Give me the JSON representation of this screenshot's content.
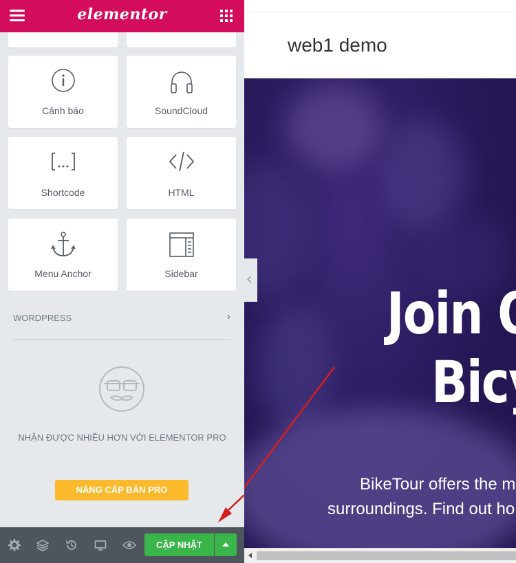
{
  "app": {
    "logo_text": "elementor",
    "brand_color": "#d30c5c"
  },
  "widgets": [
    {
      "label": "Cảnh báo",
      "icon": "alert-info-icon"
    },
    {
      "label": "SoundCloud",
      "icon": "headphones-icon"
    },
    {
      "label": "Shortcode",
      "icon": "shortcode-icon"
    },
    {
      "label": "HTML",
      "icon": "code-icon"
    },
    {
      "label": "Menu Anchor",
      "icon": "anchor-icon"
    },
    {
      "label": "Sidebar",
      "icon": "sidebar-layout-icon"
    }
  ],
  "wordpress_section": {
    "label": "WORDPRESS"
  },
  "promo": {
    "text": "NHẬN ĐƯỢC NHIỀU HƠN VỚI ELEMENTOR PRO",
    "button": "NÂNG CẤP BẢN PRO",
    "button_color": "#fcb92c"
  },
  "footer": {
    "icons": [
      "settings-icon",
      "layers-icon",
      "history-icon",
      "responsive-desktop-icon",
      "preview-eye-icon"
    ],
    "update_label": "CẬP NHẬT",
    "update_color": "#39b54a"
  },
  "preview": {
    "site_title": "web1 demo",
    "hero_line1": "Join O",
    "hero_line2": "Bicy",
    "hero_text1": "BikeTour offers the m",
    "hero_text2": "surroundings. Find out ho"
  }
}
